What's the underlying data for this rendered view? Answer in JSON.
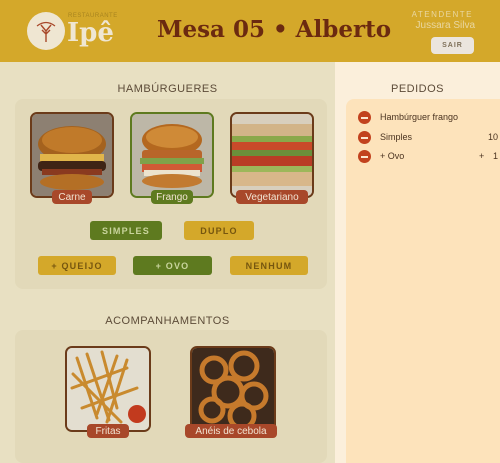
{
  "header": {
    "brand_small": "RESTAURANTE",
    "brand": "Ipê",
    "title": "Mesa 05 • Alberto",
    "attendant_label": "ATENDENTE",
    "attendant_name": "Jussara Silva",
    "logout_label": "SAIR"
  },
  "menu": {
    "burgers_title": "HAMBÚRGUERES",
    "burgers": [
      {
        "name": "Carne",
        "selected": false
      },
      {
        "name": "Frango",
        "selected": true
      },
      {
        "name": "Vegetariano",
        "selected": false
      }
    ],
    "sizes": [
      {
        "label": "SIMPLES",
        "selected": true
      },
      {
        "label": "DUPLO",
        "selected": false
      }
    ],
    "extras": [
      {
        "label": "+ QUEIJO",
        "selected": false
      },
      {
        "label": "+ OVO",
        "selected": true
      },
      {
        "label": "NENHUM",
        "selected": false
      }
    ],
    "sides_title": "ACOMPANHAMENTOS",
    "sides": [
      {
        "name": "Fritas"
      },
      {
        "name": "Anéis de cebola"
      }
    ]
  },
  "orders": {
    "title": "PEDIDOS",
    "items": [
      {
        "name": "Hambúrguer frango",
        "plus": "",
        "qty": ""
      },
      {
        "name": "Simples",
        "plus": "",
        "qty": "10"
      },
      {
        "name": "+ Ovo",
        "plus": "+",
        "qty": "1"
      }
    ]
  },
  "colors": {
    "header": "#d4a82a",
    "selected_green": "#5e7a1f",
    "label_red": "#a8482a",
    "orders_bg": "#fde3bb",
    "title_brown": "#6b2a10"
  }
}
